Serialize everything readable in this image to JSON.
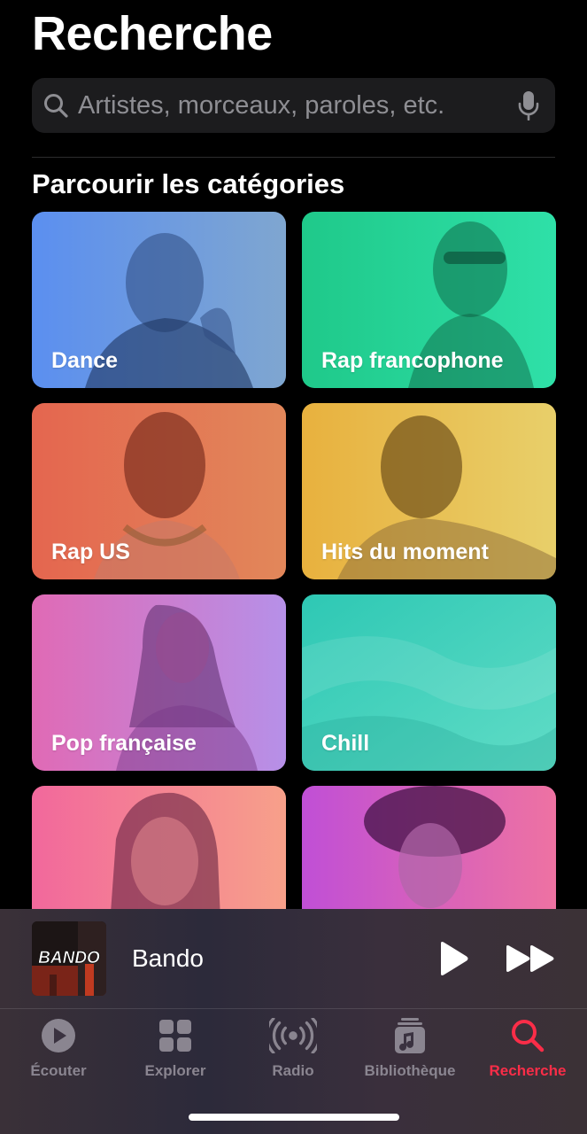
{
  "header": {
    "title": "Recherche"
  },
  "search": {
    "placeholder": "Artistes, morceaux, paroles, etc.",
    "value": ""
  },
  "browse": {
    "section_title": "Parcourir les catégories",
    "categories": [
      {
        "label": "Dance",
        "colors": [
          "#5b8ff0",
          "#7fa6d0"
        ]
      },
      {
        "label": "Rap francophone",
        "colors": [
          "#1fc98a",
          "#2fe0a8"
        ]
      },
      {
        "label": "Rap US",
        "colors": [
          "#e4664f",
          "#e2875a"
        ]
      },
      {
        "label": "Hits du moment",
        "colors": [
          "#e8b13e",
          "#e8cf6a"
        ]
      },
      {
        "label": "Pop française",
        "colors": [
          "#e06ab5",
          "#b690e8"
        ]
      },
      {
        "label": "Chill",
        "colors": [
          "#2ec8b4",
          "#60dcc6"
        ]
      },
      {
        "label": "",
        "colors": [
          "#f2689c",
          "#f7a08a"
        ]
      },
      {
        "label": "",
        "colors": [
          "#c04fd6",
          "#ee72a2"
        ]
      }
    ]
  },
  "now_playing": {
    "artwork_text": "BANDO",
    "title": "Bando"
  },
  "tab_bar": {
    "active_color": "#fa2d48",
    "inactive_color": "#8a8590",
    "tabs": [
      {
        "label": "Écouter",
        "icon": "play-circle-icon",
        "active": false
      },
      {
        "label": "Explorer",
        "icon": "grid-icon",
        "active": false
      },
      {
        "label": "Radio",
        "icon": "radio-waves-icon",
        "active": false
      },
      {
        "label": "Bibliothèque",
        "icon": "music-library-icon",
        "active": false
      },
      {
        "label": "Recherche",
        "icon": "search-icon",
        "active": true
      }
    ]
  }
}
